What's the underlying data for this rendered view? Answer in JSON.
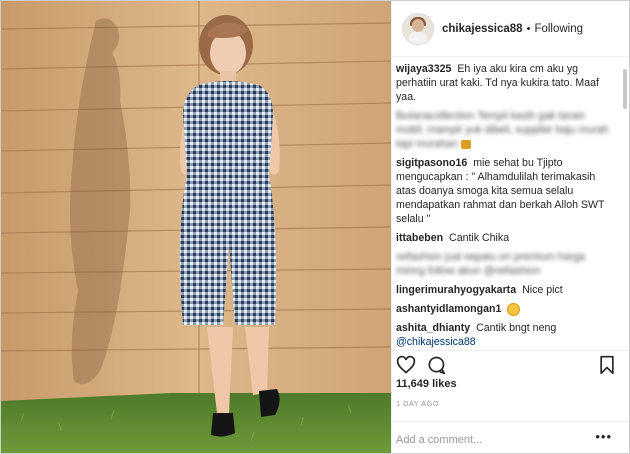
{
  "post": {
    "username": "chikajessica88",
    "separator": "•",
    "follow_status": "Following",
    "likes": "11,649 likes",
    "timestamp": "1 DAY AGO",
    "add_comment_placeholder": "Add a comment...",
    "more_label": "•••"
  },
  "comments": [
    {
      "user": "wijaya3325",
      "text": "Eh iya aku kira cm aku yg perhatiin urat kaki. Td nya kukira tato. Maaf yaa.",
      "blurred": false
    },
    {
      "user": "",
      "text": "lbulanacollection Tempil kasih gak tanan mobil, mampir yuk dibeli, supplier baju murah tapi murahan",
      "blurred": true,
      "emoji": "gift"
    },
    {
      "user": "sigitpasono16",
      "text": "mie sehat bu Tjipto mengucapkan : \" Alhamdulilah terimakasih atas doanya smoga kita semua selalu mendapatkan rahmat dan berkah Alloh SWT selalu \"",
      "blurred": false
    },
    {
      "user": "ittabeben",
      "text": "Cantik Chika",
      "blurred": false
    },
    {
      "user": "",
      "text": "reifashion jual sepatu ori premium harga miring follow akun @reifashion",
      "blurred": true
    },
    {
      "user": "lingerimurahyogyakarta",
      "text": "Nice pict",
      "blurred": false
    },
    {
      "user": "ashantyidlamongan1",
      "text": "",
      "blurred": false,
      "emoji": "face"
    },
    {
      "user": "ashita_dhianty",
      "text": "Cantik bngt neng",
      "blurred": false,
      "mention": "@chikajessica88"
    }
  ],
  "icons": {
    "like": "heart-icon",
    "comment": "comment-icon",
    "share": "share-icon",
    "save": "bookmark-icon"
  },
  "colors": {
    "text": "#262626",
    "muted": "#999999",
    "mention": "#003569",
    "border": "#efefef"
  }
}
